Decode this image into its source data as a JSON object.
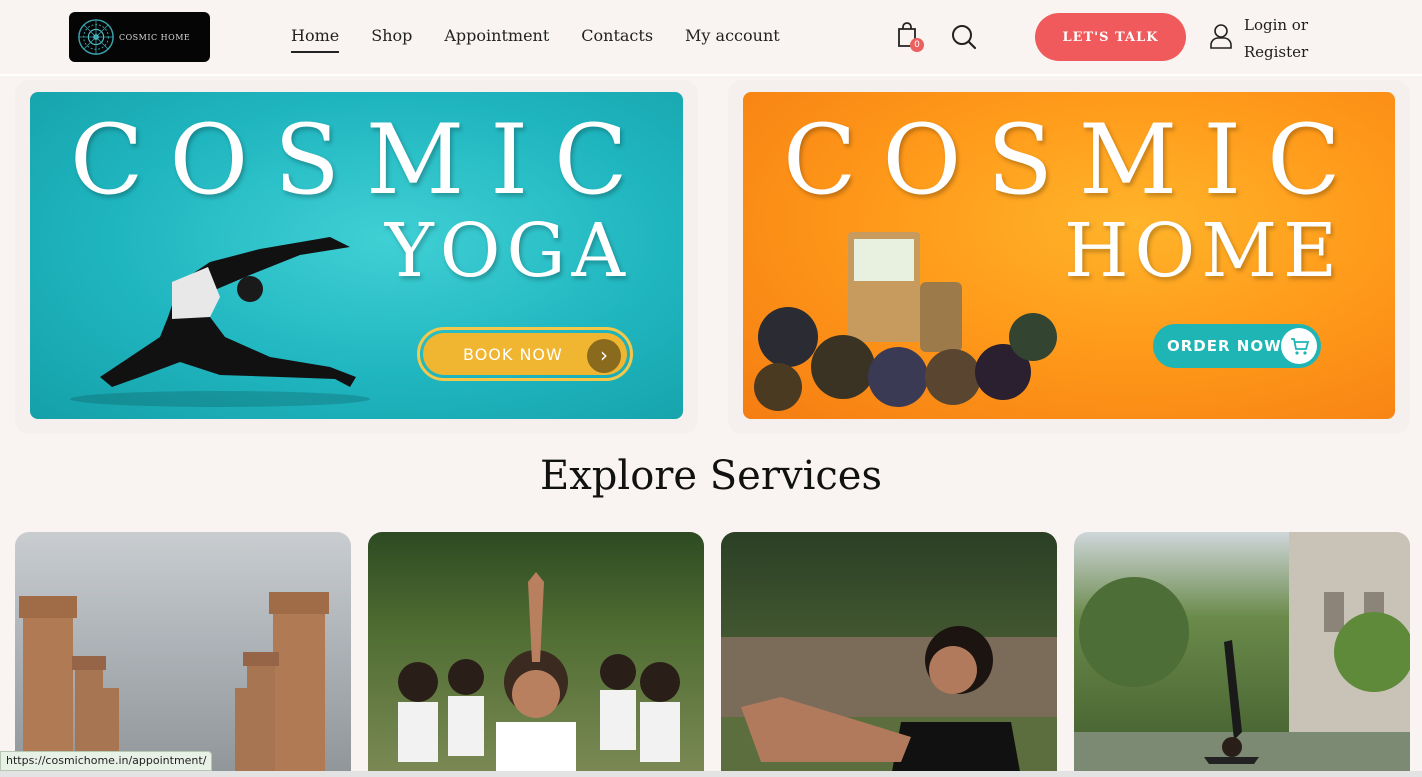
{
  "header": {
    "logo_text": "COSMIC HOME",
    "nav": [
      "Home",
      "Shop",
      "Appointment",
      "Contacts",
      "My account"
    ],
    "cart_count": "0",
    "talk_button": "LET'S TALK",
    "login_line1": "Login or",
    "login_line2": "Register"
  },
  "banners": {
    "yoga": {
      "title": "COSMIC",
      "subtitle": "YOGA",
      "button": "BOOK NOW",
      "arrow": "›"
    },
    "home": {
      "title": "COSMIC",
      "subtitle": "HOME",
      "button": "ORDER NOW"
    }
  },
  "services": {
    "heading": "Explore Services"
  },
  "status_url": "https://cosmichome.in/appointment/",
  "colors": {
    "accent": "#f05a5c",
    "background": "#f9f4f1",
    "teal": "#1fb5bf",
    "orange": "#ff9a1a",
    "book_yellow": "#f1b631"
  },
  "icons": [
    "mandala-logo-icon",
    "shopping-bag-icon",
    "search-icon",
    "user-icon",
    "chevron-right-icon",
    "cart-icon"
  ]
}
